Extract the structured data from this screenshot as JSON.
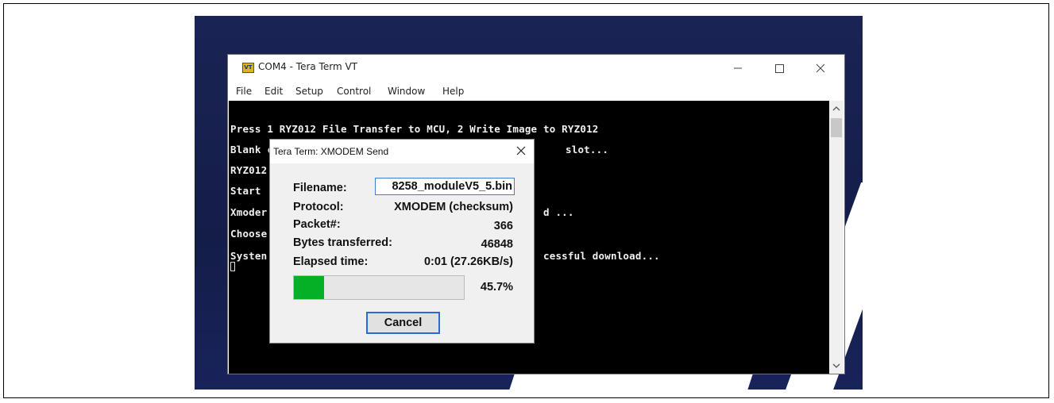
{
  "window": {
    "title": "COM4 - Tera Term VT",
    "icon": "VT",
    "controls": [
      "minimize-icon",
      "maximize-icon",
      "close-icon"
    ]
  },
  "menu": [
    "File",
    "Edit",
    "Setup",
    "Control",
    "Window",
    "Help"
  ],
  "terminal": {
    "lines": [
      "Press 1 RYZ012 File Transfer to MCU, 2 Write Image to RYZ012",
      "Blank",
      "slot...",
      "RYZ012",
      "Start",
      "Xmoder",
      "d ...",
      "Choose",
      "Systen",
      "cessful download...",
      "Blank checking the RYZ012 firmware image"
    ]
  },
  "dialog": {
    "title": "Tera Term: XMODEM Send",
    "filename_label": "Filename:",
    "filename_value": "8258_moduleV5_5.bin",
    "protocol_label": "Protocol:",
    "protocol_value": "XMODEM (checksum)",
    "packet_label": "Packet#:",
    "packet_value": "366",
    "bytes_label": "Bytes transferred:",
    "bytes_value": "46848",
    "elapsed_label": "Elapsed time:",
    "elapsed_value": "0:01 (27.26KB/s)",
    "progress_percent": 45.7,
    "progress_text": "45.7%",
    "cancel_label": "Cancel"
  },
  "colors": {
    "progress": "#06b025",
    "terminal_bg": "#000000",
    "desktop": "#1a2454"
  }
}
